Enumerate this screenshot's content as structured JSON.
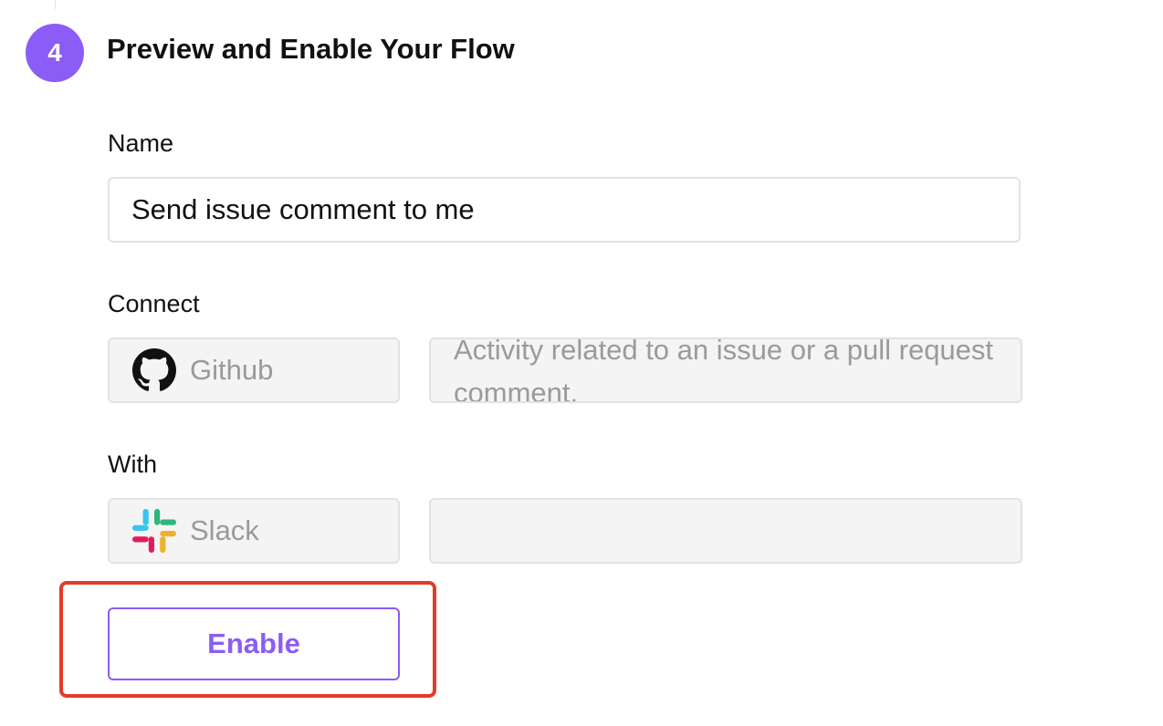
{
  "step": {
    "number": "4",
    "title": "Preview and Enable Your Flow"
  },
  "name_field": {
    "label": "Name",
    "value": "Send issue comment to me"
  },
  "connect_field": {
    "label": "Connect",
    "app": "Github",
    "app_icon": "github-icon",
    "event": "Activity related to an issue or a pull request comment."
  },
  "with_field": {
    "label": "With",
    "app": "Slack",
    "app_icon": "slack-icon",
    "event": ""
  },
  "actions": {
    "enable_label": "Enable"
  },
  "colors": {
    "accent": "#8b5cf6",
    "highlight": "#e23d28",
    "slack_blue": "#36c5f0",
    "slack_green": "#2eb67d",
    "slack_red": "#e01e5a",
    "slack_yellow": "#ecb22e"
  }
}
